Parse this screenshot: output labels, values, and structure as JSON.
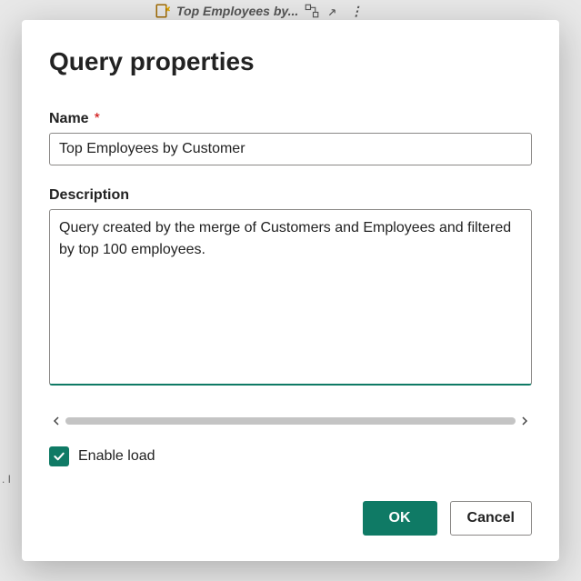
{
  "background": {
    "tab_title": "Top Employees by...",
    "left_marker": ". I"
  },
  "dialog": {
    "title": "Query properties",
    "name": {
      "label": "Name",
      "required_marker": "*",
      "value": "Top Employees by Customer"
    },
    "description": {
      "label": "Description",
      "value": "Query created by the merge of Customers and Employees and filtered by top 100 employees."
    },
    "enable_load": {
      "label": "Enable load",
      "checked": true
    },
    "buttons": {
      "ok": "OK",
      "cancel": "Cancel"
    }
  }
}
